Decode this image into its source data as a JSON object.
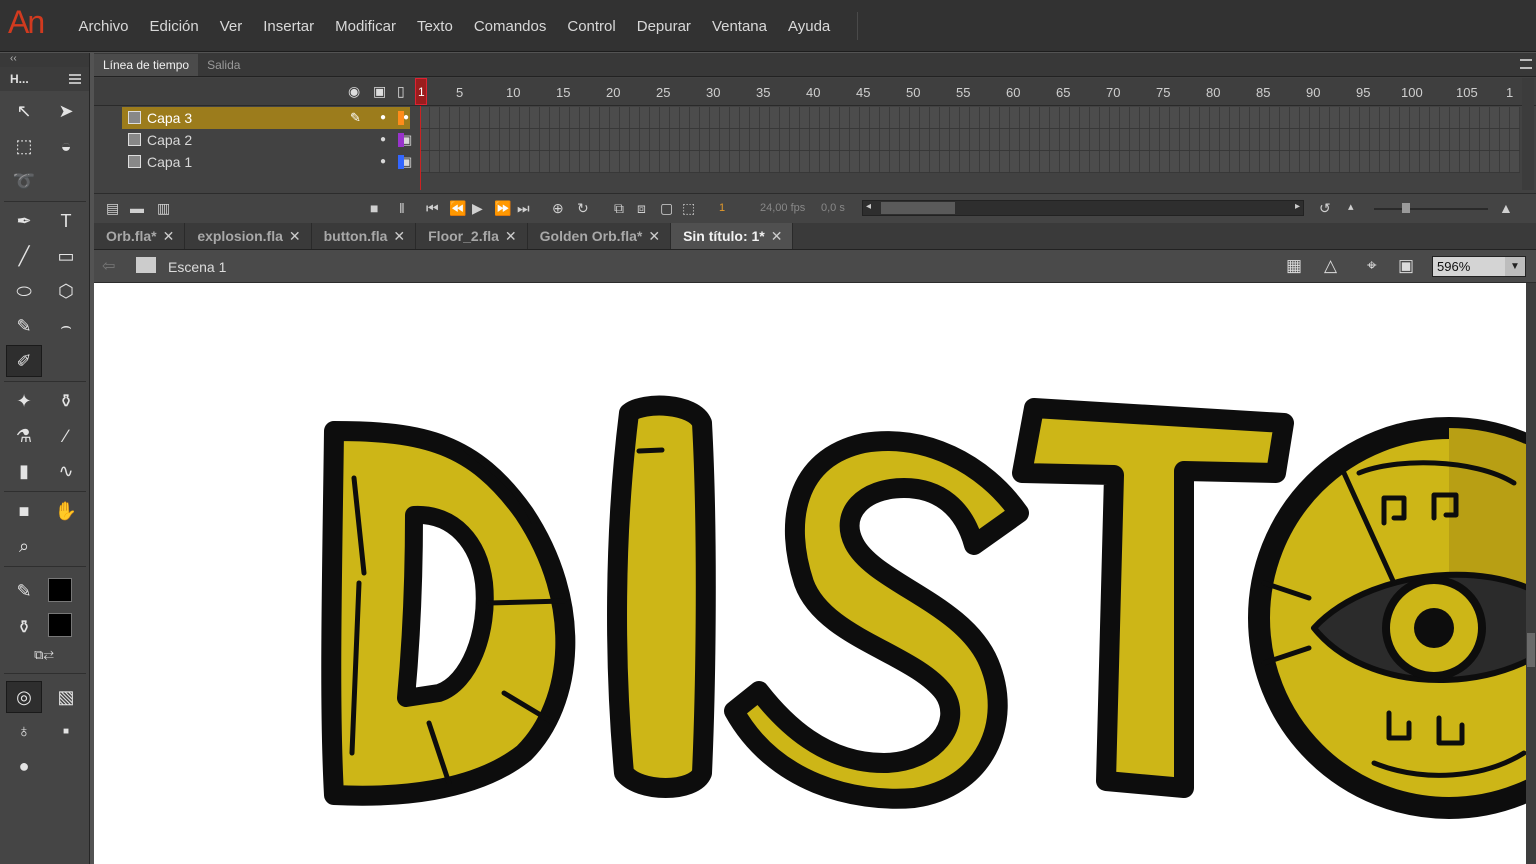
{
  "app": {
    "logo": "An"
  },
  "menu": [
    "Archivo",
    "Edición",
    "Ver",
    "Insertar",
    "Modificar",
    "Texto",
    "Comandos",
    "Control",
    "Depurar",
    "Ventana",
    "Ayuda"
  ],
  "toolbar": {
    "head": "‹‹",
    "title": "H..."
  },
  "timeline": {
    "tabs": [
      "Línea de tiempo",
      "Salida"
    ],
    "frame_numbers": [
      "1",
      "5",
      "10",
      "15",
      "20",
      "25",
      "30",
      "35",
      "40",
      "45",
      "50",
      "55",
      "60",
      "65",
      "70",
      "75",
      "80",
      "85",
      "90",
      "95",
      "100",
      "105",
      "1"
    ],
    "current_frame": "1",
    "layers": [
      {
        "name": "Capa 3",
        "color": "#ff8c1a",
        "selected": true
      },
      {
        "name": "Capa 2",
        "color": "#9933cc",
        "selected": false
      },
      {
        "name": "Capa 1",
        "color": "#3366ff",
        "selected": false
      }
    ],
    "footer": {
      "frame": "1",
      "fps": "24,00 fps",
      "time": "0,0 s"
    }
  },
  "doc_tabs": [
    {
      "label": "Orb.fla*",
      "active": false
    },
    {
      "label": "explosion.fla",
      "active": false
    },
    {
      "label": "button.fla",
      "active": false
    },
    {
      "label": "Floor_2.fla",
      "active": false
    },
    {
      "label": "Golden Orb.fla*",
      "active": false
    },
    {
      "label": "Sin título: 1*",
      "active": true
    }
  ],
  "scene": {
    "label": "Escena 1",
    "zoom": "596%"
  },
  "colors": {
    "letter_fill": "#cdb617",
    "outline": "#0d0d0d",
    "selected_layer": "#9c7c1c"
  }
}
